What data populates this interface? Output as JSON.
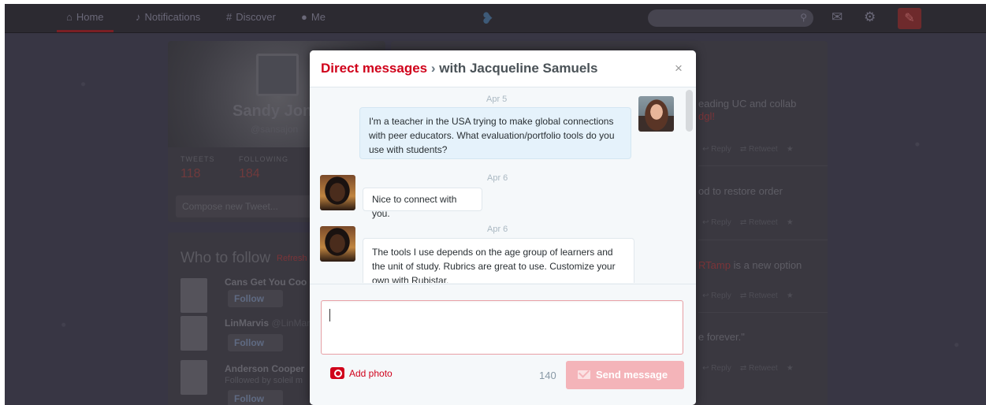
{
  "nav": {
    "home": "Home",
    "notifications": "Notifications",
    "discover": "Discover",
    "me": "Me",
    "search_placeholder": "Search"
  },
  "profile": {
    "name": "Sandy Jon",
    "handle": "@sansajon",
    "tweets_label": "TWEETS",
    "tweets_count": "118",
    "following_label": "FOLLOWING",
    "following_count": "184",
    "compose_placeholder": "Compose new Tweet..."
  },
  "who_to_follow": {
    "title": "Who to follow",
    "refresh": "Refresh",
    "items": [
      {
        "name": "Cans Get You Coo",
        "sub": "",
        "follow": "Follow"
      },
      {
        "name": "LinMarvis",
        "sub": "@LinMar",
        "follow": "Follow"
      },
      {
        "name": "Anderson Cooper",
        "sub": "Followed by soleil m",
        "follow": "Follow"
      }
    ]
  },
  "timeline": {
    "lines": [
      {
        "pre": "eading UC and collab",
        "hl": ""
      },
      {
        "pre": "",
        "hl": "dgl!"
      },
      {
        "pre": "od to restore order",
        "hl": ""
      },
      {
        "pre": " is a new option",
        "hl": "RTamp"
      },
      {
        "pre": "e forever.\"",
        "hl": ""
      }
    ]
  },
  "dm_modal": {
    "title_prefix": "Direct messages",
    "title_separator": " › ",
    "title_suffix": "with Jacqueline Samuels",
    "close": "×",
    "messages": [
      {
        "date": "Apr 5",
        "direction": "sent",
        "text": "I'm a teacher in the USA trying to make global connections with peer educators.  What evaluation/portfolio tools do you use with students?"
      },
      {
        "date": "Apr 6",
        "direction": "received",
        "text": "Nice to connect with you."
      },
      {
        "date": "Apr 6",
        "direction": "received",
        "text": "The tools I use depends on the age group of learners and the unit of study. Rubrics are great to use. Customize your own with Rubistar."
      }
    ],
    "composer": {
      "input_value": "",
      "add_photo": "Add photo",
      "char_count": "140",
      "send_label": "Send message"
    }
  },
  "colors": {
    "accent": "#d0021b",
    "send_disabled": "#f4b4b9",
    "sent_bubble": "#e5f2fb",
    "backdrop": "#383644"
  }
}
